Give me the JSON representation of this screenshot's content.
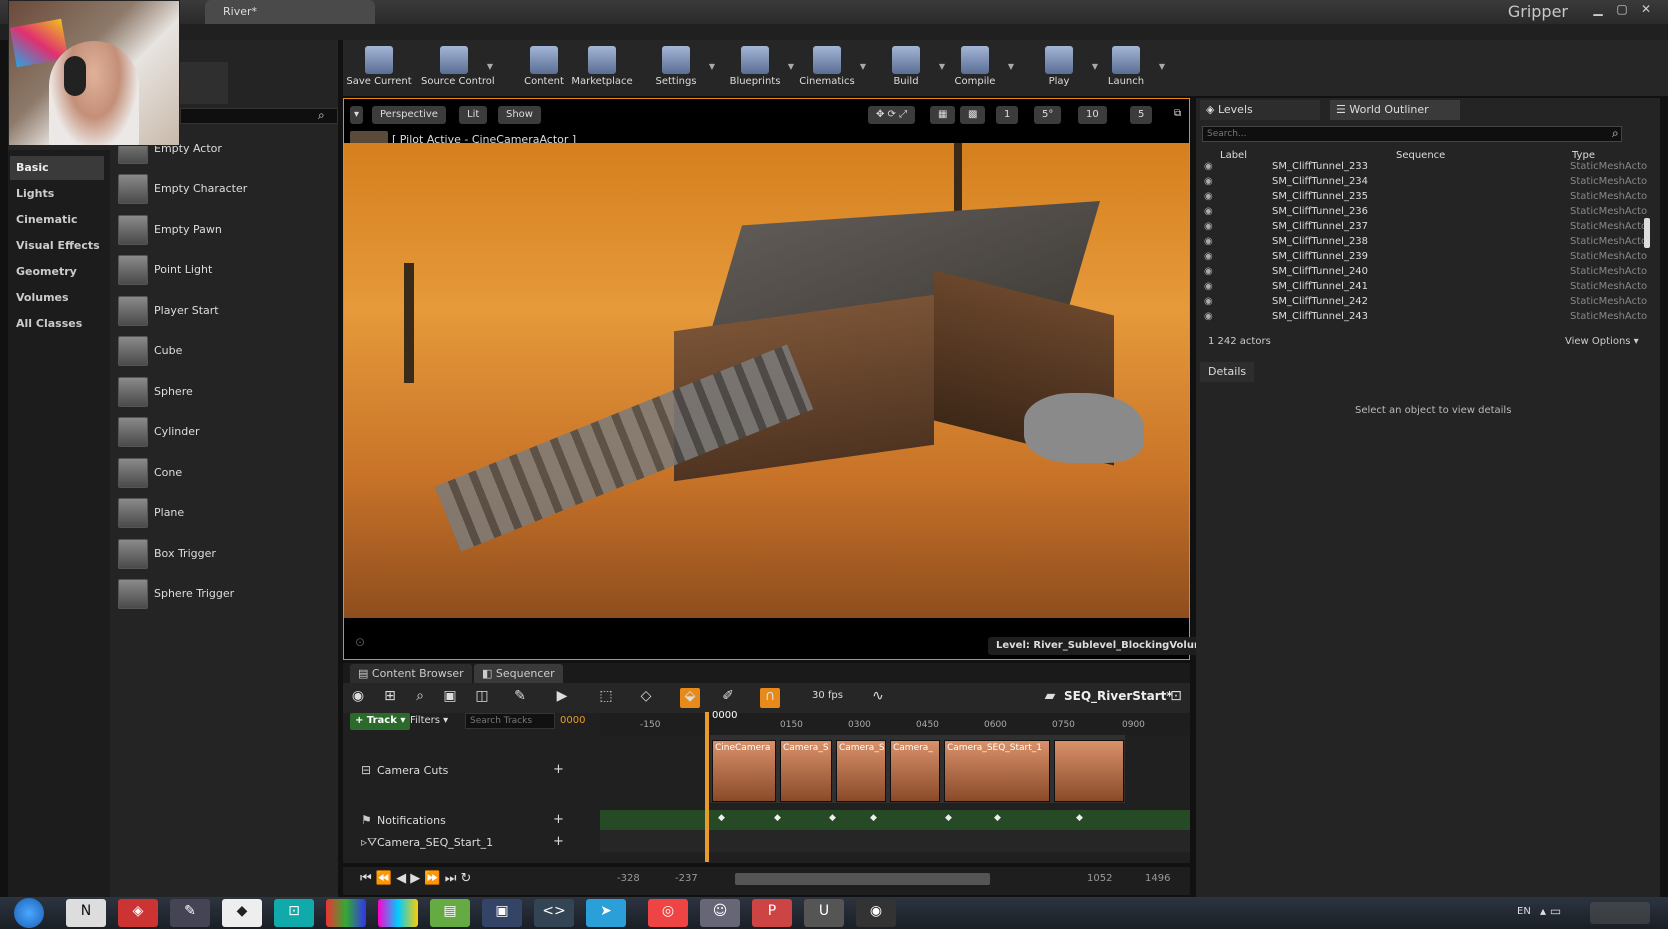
{
  "window": {
    "tab_title": "River*",
    "app_name": "Gripper"
  },
  "place_actors": {
    "categories": [
      "Basic",
      "Lights",
      "Cinematic",
      "Visual Effects",
      "Geometry",
      "Volumes",
      "All Classes"
    ],
    "actors": [
      "Empty Actor",
      "Empty Character",
      "Empty Pawn",
      "Point Light",
      "Player Start",
      "Cube",
      "Sphere",
      "Cylinder",
      "Cone",
      "Plane",
      "Box Trigger",
      "Sphere Trigger"
    ]
  },
  "toolbar": {
    "buttons": [
      "Save Current",
      "Source Control",
      "Content",
      "Marketplace",
      "Settings",
      "Blueprints",
      "Cinematics",
      "Build",
      "Compile",
      "Play",
      "Launch"
    ]
  },
  "viewport": {
    "perspective": "Perspective",
    "lit": "Lit",
    "show": "Show",
    "pilot_text": "[ Pilot Active - CineCameraActor ]",
    "level_label": "Level:  River_Sublevel_BlockingVolumes",
    "snap_values": [
      "1",
      "5°",
      "10",
      "5"
    ]
  },
  "sequencer": {
    "tabs": [
      "Content Browser",
      "Sequencer"
    ],
    "fps": "30 fps",
    "sequence_name": "SEQ_RiverStart*",
    "track_btn": "+ Track ▾",
    "filters_btn": "Filters ▾",
    "search_placeholder": "Search Tracks",
    "current_frame": "0000",
    "playhead_label": "0000",
    "ruler_ticks": [
      "-150",
      "0150",
      "0300",
      "0450",
      "0600",
      "0750",
      "0900"
    ],
    "tracks": [
      "Camera Cuts",
      "Notifications",
      "Camera_SEQ_Start_1"
    ],
    "cuts": [
      "CineCamera",
      "Camera_S",
      "Camera_S",
      "Camera_",
      "Camera_SEQ_Start_1",
      ""
    ],
    "range": [
      "-328",
      "-237",
      "1052",
      "1496"
    ]
  },
  "outliner": {
    "tabs": [
      "Levels",
      "World Outliner"
    ],
    "search_placeholder": "Search...",
    "columns": [
      "Label",
      "Sequence",
      "Type"
    ],
    "rows": [
      {
        "name": "SM_CliffTunnel_233",
        "type": "StaticMeshActo"
      },
      {
        "name": "SM_CliffTunnel_234",
        "type": "StaticMeshActo"
      },
      {
        "name": "SM_CliffTunnel_235",
        "type": "StaticMeshActo"
      },
      {
        "name": "SM_CliffTunnel_236",
        "type": "StaticMeshActo"
      },
      {
        "name": "SM_CliffTunnel_237",
        "type": "StaticMeshActo"
      },
      {
        "name": "SM_CliffTunnel_238",
        "type": "StaticMeshActo"
      },
      {
        "name": "SM_CliffTunnel_239",
        "type": "StaticMeshActo"
      },
      {
        "name": "SM_CliffTunnel_240",
        "type": "StaticMeshActo"
      },
      {
        "name": "SM_CliffTunnel_241",
        "type": "StaticMeshActo"
      },
      {
        "name": "SM_CliffTunnel_242",
        "type": "StaticMeshActo"
      },
      {
        "name": "SM_CliffTunnel_243",
        "type": "StaticMeshActo"
      }
    ],
    "actor_count": "1 242 actors",
    "view_options": "View Options ▾"
  },
  "details": {
    "tab": "Details",
    "message": "Select an object to view details"
  },
  "taskbar": {
    "language": "EN"
  },
  "colors": {
    "accent": "#e88a1a",
    "panel": "#242424",
    "track_green": "#264a26"
  }
}
